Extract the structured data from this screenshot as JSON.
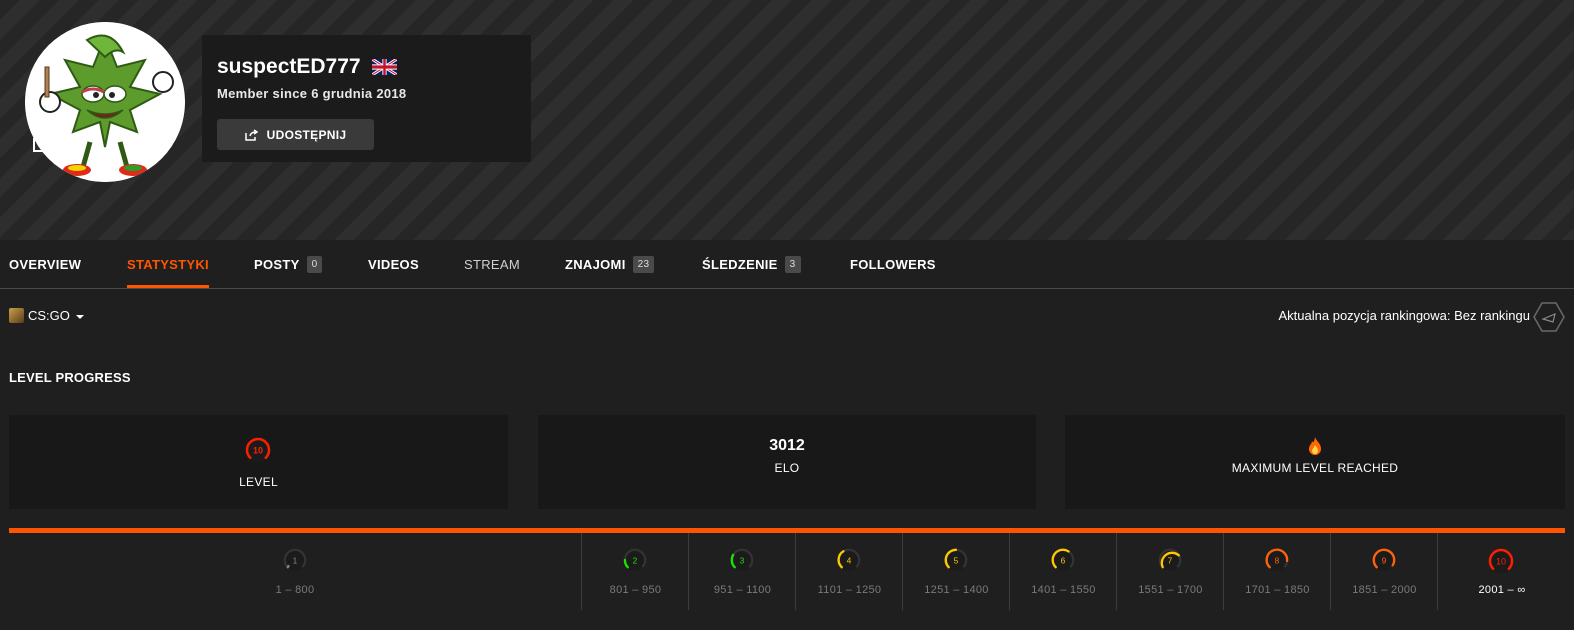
{
  "profile": {
    "nickname": "suspectED777",
    "member_since": "Member since 6 grudnia 2018",
    "share_label": "UDOSTĘPNIJ",
    "country_flag": "uk-flag-icon"
  },
  "tabs": [
    {
      "label": "OVERVIEW"
    },
    {
      "label": "STATYSTYKI",
      "active": true
    },
    {
      "label": "POSTY",
      "badge": "0"
    },
    {
      "label": "VIDEOS"
    },
    {
      "label": "STREAM"
    },
    {
      "label": "ZNAJOMI",
      "badge": "23"
    },
    {
      "label": "ŚLEDZENIE",
      "badge": "3"
    },
    {
      "label": "FOLLOWERS"
    }
  ],
  "game_select": {
    "label": "CS:GO"
  },
  "ranking": {
    "text": "Aktualna pozycja rankingowa: Bez rankingu"
  },
  "level_progress": {
    "title": "LEVEL PROGRESS",
    "level": {
      "value": "10",
      "label": "LEVEL"
    },
    "elo": {
      "value": "3012",
      "label": "ELO"
    },
    "max": {
      "label": "MAXIMUM LEVEL REACHED"
    },
    "progress_fraction": 1.0
  },
  "levels": [
    {
      "num": "1",
      "range": "1 – 800",
      "color": "#888888"
    },
    {
      "num": "2",
      "range": "801 – 950",
      "color": "#1ce400"
    },
    {
      "num": "3",
      "range": "951 – 1100",
      "color": "#1ce400"
    },
    {
      "num": "4",
      "range": "1101 – 1250",
      "color": "#ffc800"
    },
    {
      "num": "5",
      "range": "1251 – 1400",
      "color": "#ffc800"
    },
    {
      "num": "6",
      "range": "1401 – 1550",
      "color": "#ffc800"
    },
    {
      "num": "7",
      "range": "1551 – 1700",
      "color": "#ffc800"
    },
    {
      "num": "8",
      "range": "1701 – 1850",
      "color": "#ff6309"
    },
    {
      "num": "9",
      "range": "1851 – 2000",
      "color": "#ff6309"
    },
    {
      "num": "10",
      "range": "2001 – ∞",
      "color": "#fe1f00",
      "current": true
    }
  ],
  "colors": {
    "accent": "#ff5500",
    "level10": "#fe1f00"
  }
}
